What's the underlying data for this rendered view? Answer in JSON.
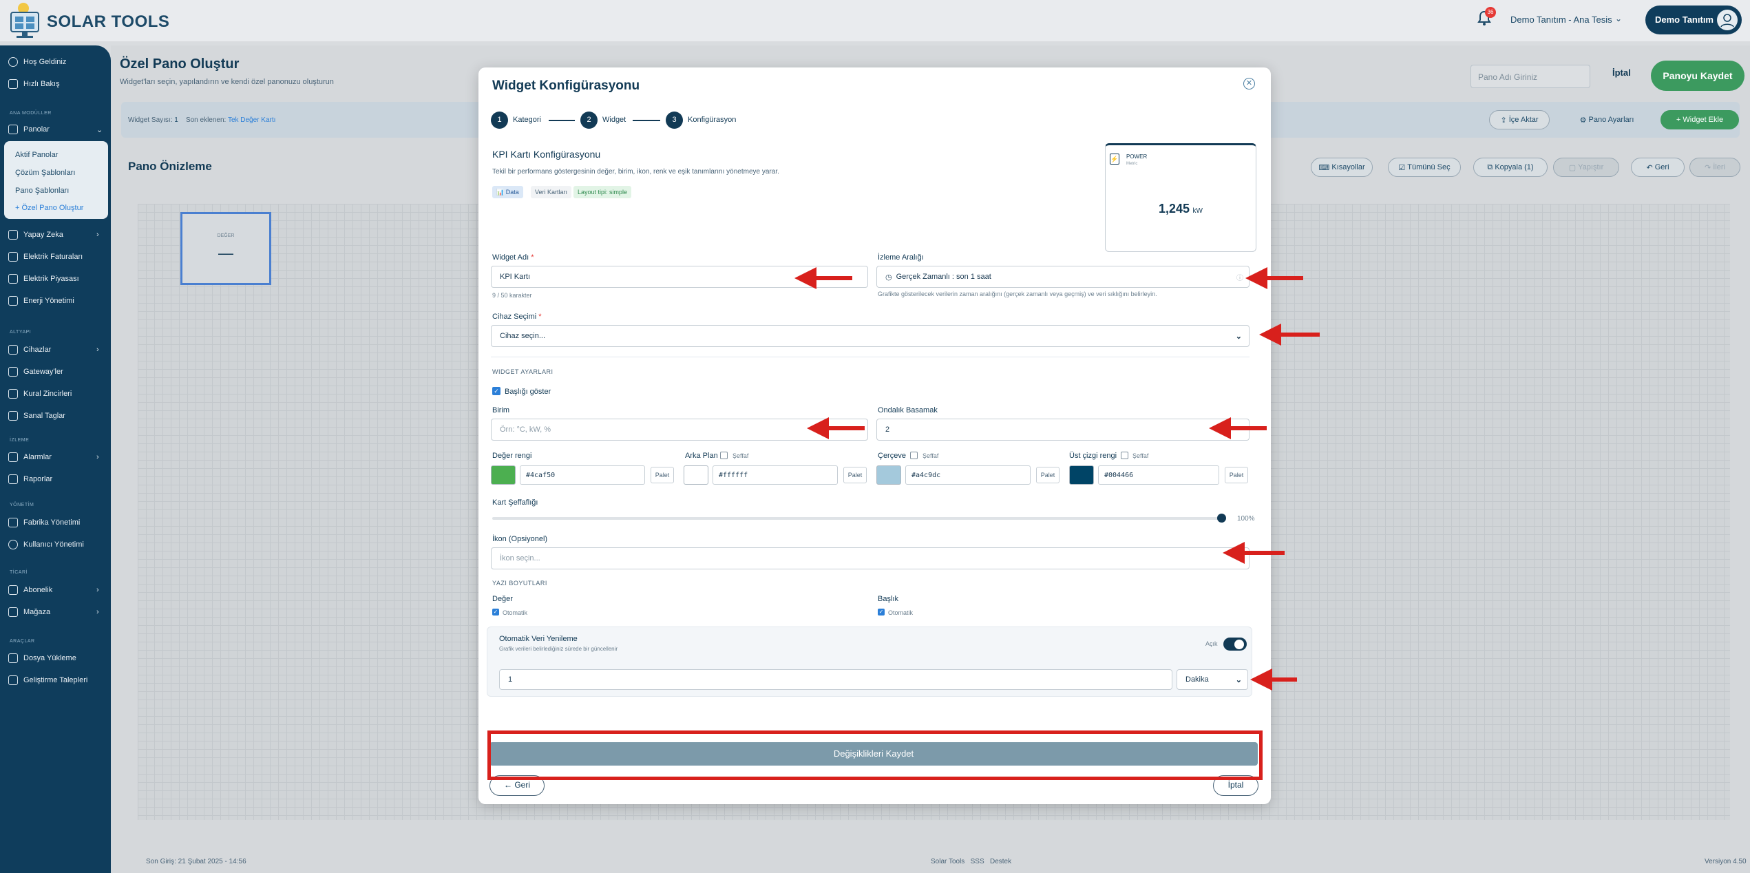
{
  "app": {
    "name": "SOLAR TOOLS",
    "notification_count": "36",
    "tenant": "Demo Tanıtım - Ana Tesis",
    "user": "Demo Tanıtım"
  },
  "sidebar": {
    "welcome": "Hoş Geldiniz",
    "quick": "Hızlı Bakış",
    "sec_main": "ANA MODÜLLER",
    "panolar": "Panolar",
    "panolar_sub": [
      "Aktif Panolar",
      "Çözüm Şablonları",
      "Pano Şablonları",
      "+ Özel Pano Oluştur"
    ],
    "items1": [
      "Yapay Zeka",
      "Elektrik Faturaları",
      "Elektrik Piyasası",
      "Enerji Yönetimi"
    ],
    "sec_infra": "ALTYAPI",
    "items2": [
      "Cihazlar",
      "Gateway'ler",
      "Kural Zincirleri",
      "Sanal Taglar"
    ],
    "sec_monitor": "İZLEME",
    "items3": [
      "Alarmlar",
      "Raporlar"
    ],
    "sec_admin": "YÖNETİM",
    "items4": [
      "Fabrika Yönetimi",
      "Kullanıcı Yönetimi"
    ],
    "sec_trade": "TİCARİ",
    "items5": [
      "Abonelik",
      "Mağaza"
    ],
    "sec_tools": "ARAÇLAR",
    "items6": [
      "Dosya Yükleme",
      "Geliştirme Talepleri"
    ]
  },
  "page": {
    "title": "Özel Pano Oluştur",
    "subtitle": "Widget'ları seçin, yapılandırın ve kendi özel panonuzu oluşturun",
    "name_placeholder": "Pano Adı Giriniz",
    "cancel": "İptal",
    "save": "Panoyu Kaydet",
    "widget_count_label": "Widget Sayısı:",
    "widget_count": "1",
    "last_added_label": "Son eklenen:",
    "last_added": "Tek Değer Kartı",
    "import": "İçe Aktar",
    "settings": "Pano Ayarları",
    "add_widget": "+ Widget Ekle",
    "preview_title": "Pano Önizleme",
    "shortcuts": "Kısayollar",
    "select_all": "Tümünü Seç",
    "copy": "Kopyala (1)",
    "paste": "Yapıştır",
    "undo": "Geri",
    "redo": "İleri",
    "mini_label": "DEĞER",
    "mini_value": "—",
    "footer_left": "Son Giriş: 21 Şubat 2025 - 14:56",
    "footer_mid": [
      "Solar Tools",
      "SSS",
      "Destek"
    ],
    "footer_ver": "Versiyon 4.50"
  },
  "modal": {
    "title": "Widget Konfigürasyonu",
    "steps": [
      {
        "n": "1",
        "label": "Kategori"
      },
      {
        "n": "2",
        "label": "Widget"
      },
      {
        "n": "3",
        "label": "Konfigürasyon"
      }
    ],
    "kpi_title": "KPI Kartı Konfigürasyonu",
    "kpi_desc": "Tekil bir performans göstergesinin değer, birim, ikon, renk ve eşik tanımlarını yönetmeye yarar.",
    "tags": [
      "📊 Data",
      "Veri Kartları",
      "Layout tipi: simple"
    ],
    "preview": {
      "label": "POWER",
      "sub": "Metric",
      "value": "1,245",
      "unit": "kW"
    },
    "widget_name_label": "Widget Adı",
    "widget_name": "KPI Kartı",
    "widget_name_hint": "9 / 50 karakter",
    "range_label": "İzleme Aralığı",
    "range_value": "Gerçek Zamanlı : son 1 saat",
    "range_hint": "Grafikte gösterilecek verilerin zaman aralığını (gerçek zamanlı veya geçmiş) ve veri sıklığını belirleyin.",
    "device_label": "Cihaz Seçimi",
    "device_placeholder": "Cihaz seçin...",
    "settings_section": "WIDGET AYARLARI",
    "show_title": "Başlığı göster",
    "unit_label": "Birim",
    "unit_placeholder": "Örn: °C, kW, %",
    "decimals_label": "Ondalık Basamak",
    "decimals": "2",
    "colors": [
      {
        "label": "Değer rengi",
        "hex": "#4caf50",
        "color": "#4caf50",
        "transparent": ""
      },
      {
        "label": "Arka Plan",
        "hex": "#ffffff",
        "color": "#ffffff",
        "transparent": "Şeffaf"
      },
      {
        "label": "Çerçeve",
        "hex": "#a4c9dc",
        "color": "#a4c9dc",
        "transparent": "Şeffaf"
      },
      {
        "label": "Üst çizgi rengi",
        "hex": "#004466",
        "color": "#004466",
        "transparent": "Şeffaf"
      }
    ],
    "palette": "Palet",
    "opacity_label": "Kart Şeffaflığı",
    "opacity": "100%",
    "icon_label": "İkon (Opsiyonel)",
    "icon_placeholder": "İkon seçin...",
    "font_section": "YAZI BOYUTLARI",
    "font_value": "Değer",
    "font_title": "Başlık",
    "auto": "Otomatik",
    "auto_refresh": "Otomatik Veri Yenileme",
    "auto_refresh_desc": "Grafik verileri belirlediğiniz sürede bir güncellenir",
    "toggle_label": "Açık",
    "interval": "1",
    "interval_unit": "Dakika",
    "save": "Değişiklikleri Kaydet",
    "back": "← Geri",
    "cancel": "İptal"
  }
}
